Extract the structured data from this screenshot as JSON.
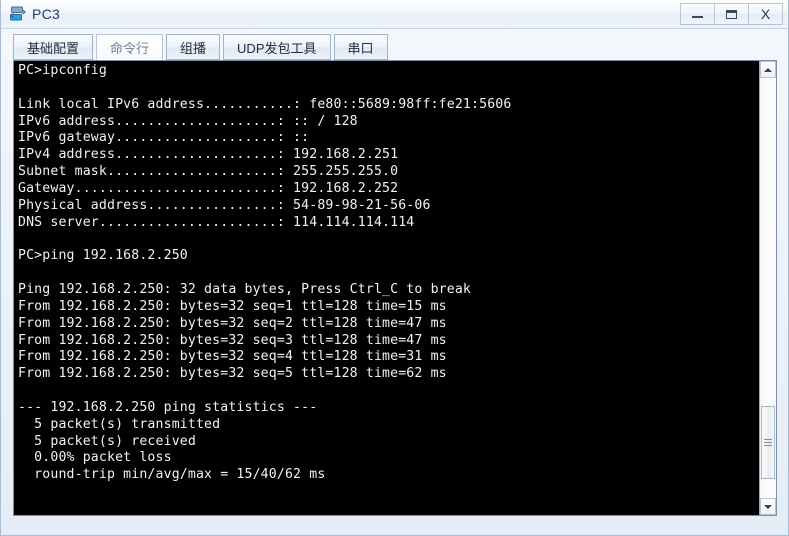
{
  "window": {
    "title": "PC3",
    "icon": "pc-device-icon",
    "controls": {
      "minimize": "–",
      "maximize": "▭",
      "close": "X"
    }
  },
  "tabs": [
    {
      "label": "基础配置",
      "name": "tab-basic-config",
      "active": false
    },
    {
      "label": "命令行",
      "name": "tab-command-line",
      "active": true
    },
    {
      "label": "组播",
      "name": "tab-multicast",
      "active": false
    },
    {
      "label": "UDP发包工具",
      "name": "tab-udp-tool",
      "active": false
    },
    {
      "label": "串口",
      "name": "tab-serial-port",
      "active": false
    }
  ],
  "console": {
    "background": "#000000",
    "foreground": "#f2f2f2",
    "text": "PC>ipconfig\n\nLink local IPv6 address...........: fe80::5689:98ff:fe21:5606\nIPv6 address....................: :: / 128\nIPv6 gateway....................: ::\nIPv4 address....................: 192.168.2.251\nSubnet mask.....................: 255.255.255.0\nGateway.........................: 192.168.2.252\nPhysical address................: 54-89-98-21-56-06\nDNS server......................: 114.114.114.114\n\nPC>ping 192.168.2.250\n\nPing 192.168.2.250: 32 data bytes, Press Ctrl_C to break\nFrom 192.168.2.250: bytes=32 seq=1 ttl=128 time=15 ms\nFrom 192.168.2.250: bytes=32 seq=2 ttl=128 time=47 ms\nFrom 192.168.2.250: bytes=32 seq=3 ttl=128 time=47 ms\nFrom 192.168.2.250: bytes=32 seq=4 ttl=128 time=31 ms\nFrom 192.168.2.250: bytes=32 seq=5 ttl=128 time=62 ms\n\n--- 192.168.2.250 ping statistics ---\n  5 packet(s) transmitted\n  5 packet(s) received\n  0.00% packet loss\n  round-trip min/avg/max = 15/40/62 ms"
  },
  "scrollbar": {
    "up_arrow": "scroll-up-arrow",
    "down_arrow": "scroll-down-arrow",
    "thumb": "scroll-thumb"
  }
}
